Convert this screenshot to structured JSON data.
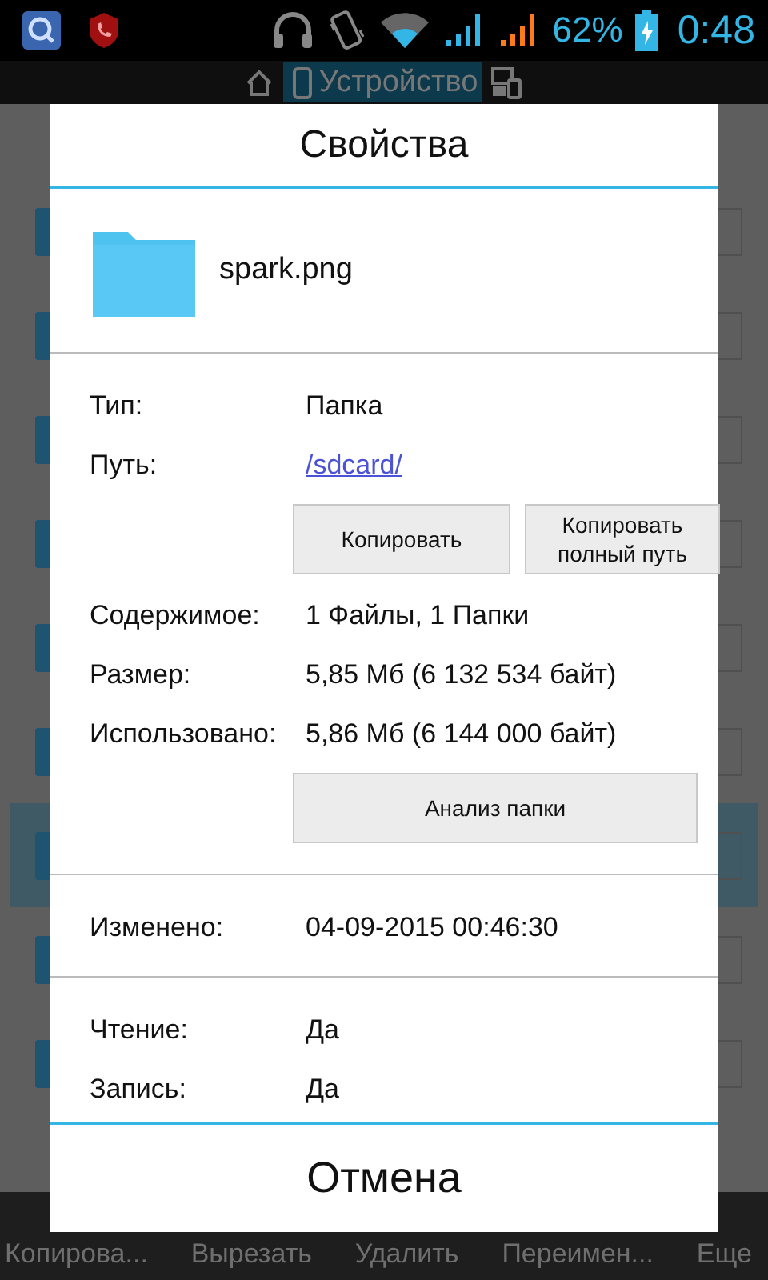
{
  "status_bar": {
    "battery": "62%",
    "time": "0:48"
  },
  "location_bar": {
    "label": "Устройство",
    "selected": true
  },
  "file_list": {
    "rows": [
      {
        "selected": false
      },
      {
        "selected": false
      },
      {
        "selected": false
      },
      {
        "selected": false
      },
      {
        "selected": false
      },
      {
        "selected": false
      },
      {
        "selected": true
      },
      {
        "selected": false
      },
      {
        "selected": false
      }
    ]
  },
  "dialog": {
    "title": "Свойства",
    "file_name": "spark.png",
    "sections": [
      {
        "rows": [
          {
            "kind": "text",
            "label": "Тип:",
            "value": "Папка"
          },
          {
            "kind": "link",
            "label": "Путь:",
            "value": "/sdcard/"
          },
          {
            "kind": "buttons",
            "buttons": [
              "Копировать",
              "Копировать полный путь"
            ]
          },
          {
            "kind": "text",
            "label": "Содержимое:",
            "value": "1 Файлы, 1 Папки"
          },
          {
            "kind": "text",
            "label": "Размер:",
            "value": "5,85 Мб (6 132 534 байт)"
          },
          {
            "kind": "text",
            "label": "Использовано:",
            "value": "5,86 Мб (6 144 000 байт)"
          },
          {
            "kind": "buttons",
            "buttons": [
              "Анализ папки"
            ]
          }
        ]
      },
      {
        "rows": [
          {
            "kind": "text",
            "label": "Изменено:",
            "value": "04-09-2015 00:46:30"
          }
        ]
      },
      {
        "rows": [
          {
            "kind": "text",
            "label": "Чтение:",
            "value": "Да"
          },
          {
            "kind": "text",
            "label": "Запись:",
            "value": "Да"
          }
        ]
      }
    ],
    "cancel": "Отмена"
  },
  "bottom_bar": {
    "actions": [
      "Копирова...",
      "Вырезать",
      "Удалить",
      "Переимен...",
      "Еще"
    ]
  }
}
